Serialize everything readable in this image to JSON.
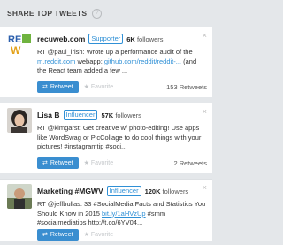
{
  "header": {
    "title": "SHARE TOP TWEETS",
    "help_glyph": "?"
  },
  "buttons": {
    "retweet": "Retweet",
    "favorite": "Favorite"
  },
  "cards": [
    {
      "name": "recuweb.com",
      "role": "Supporter",
      "followers_num": "6K",
      "followers_word": "followers",
      "tweet_pre": "RT @paul_irish: Wrote up a performance audit of the ",
      "link1": "m.reddit.com",
      "tweet_mid": " webapp: ",
      "link2": "github.com/reddit/reddit-...",
      "tweet_post": " (and the React team added a few ...",
      "count": "153 Retweets"
    },
    {
      "name": "Lisa B",
      "role": "Influencer",
      "followers_num": "57K",
      "followers_word": "followers",
      "tweet": "RT @kimgarst: Get creative w/ photo-editing! Use apps like WordSwag or PicCollage to do cool things with your pictures! #instagramtip #soci...",
      "count": "2 Retweets"
    },
    {
      "name": "Marketing #MGWV",
      "role": "Influencer",
      "followers_num": "120K",
      "followers_word": "followers",
      "tweet_pre": "RT @jeffbullas: 33 #SocialMedia Facts and Statistics You Should Know in 2015 ",
      "link1": "bit.ly/1aHVzUp",
      "tweet_post": " #smm #socialmediatips http://t.co/6YV04...",
      "count": ""
    }
  ],
  "colors": {
    "accent": "#2f90d6",
    "retweet_button": "#3a8ed0",
    "background": "#e4e7ea"
  }
}
